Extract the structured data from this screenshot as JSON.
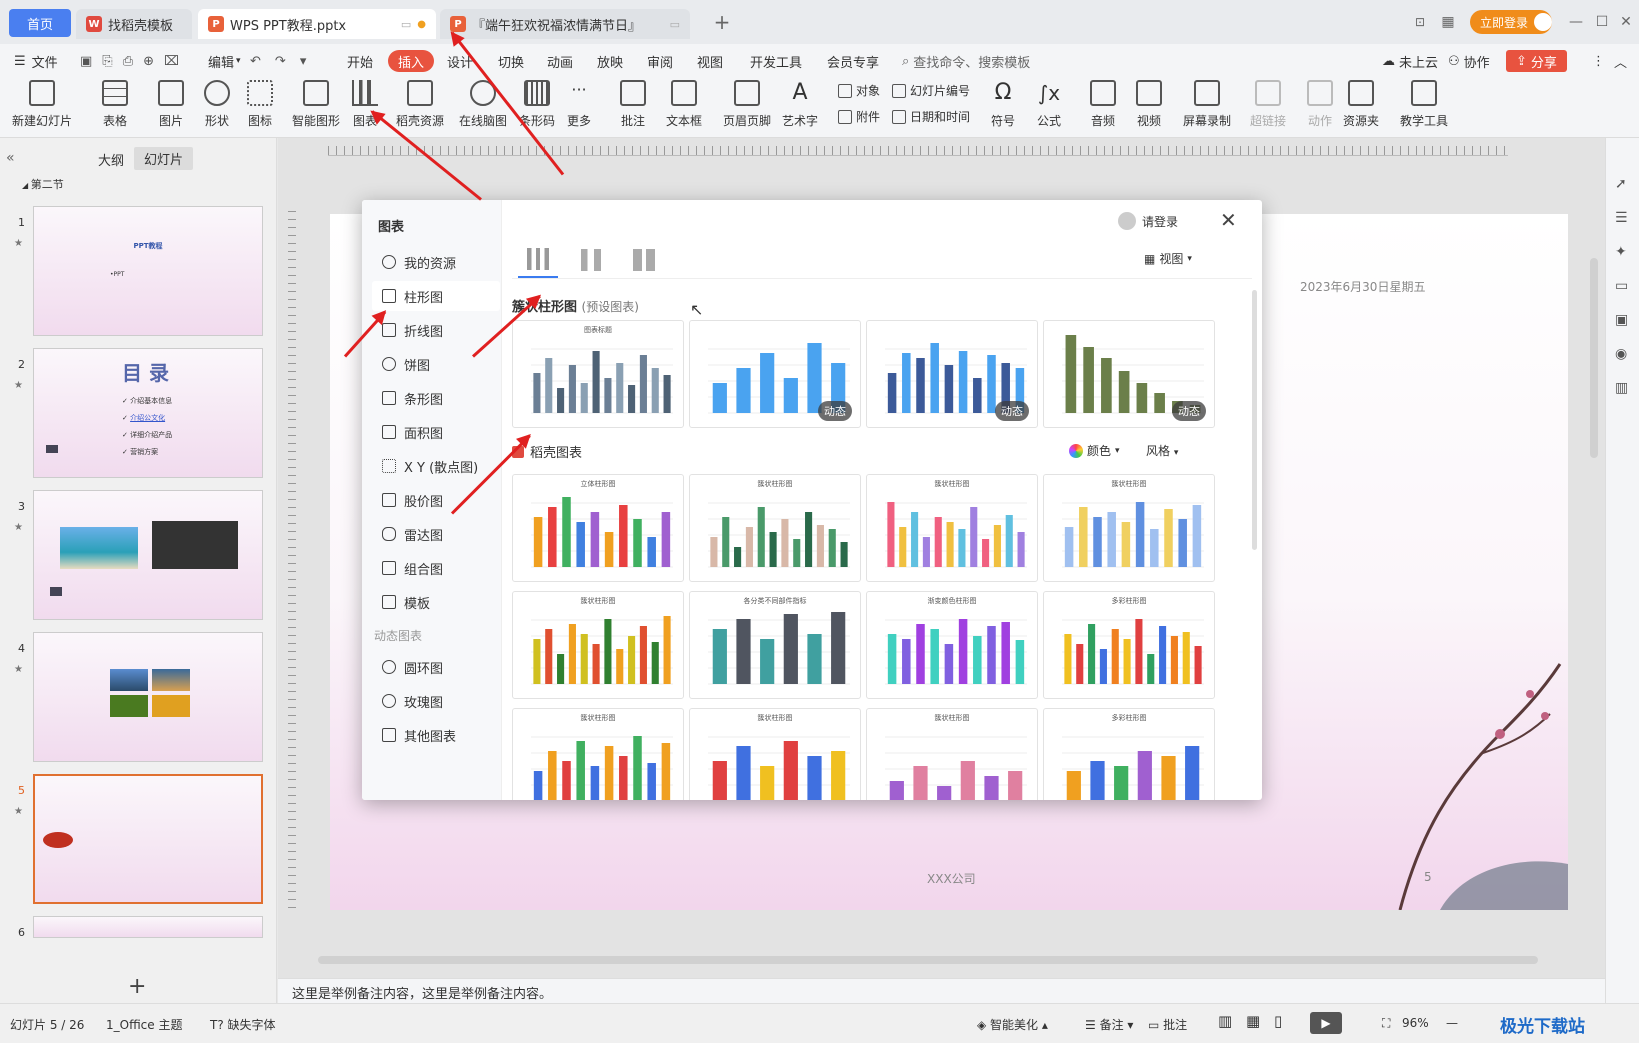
{
  "tabs": {
    "home": "首页",
    "tab1": "找稻壳模板",
    "tab2": "WPS PPT教程.pptx",
    "tab3": "『端午狂欢祝福浓情满节日』",
    "add": "+",
    "login": "立即登录"
  },
  "menu": {
    "file": "文件",
    "edit": "编辑",
    "items": [
      "开始",
      "插入",
      "设计",
      "切换",
      "动画",
      "放映",
      "审阅",
      "视图",
      "开发工具",
      "会员专享"
    ],
    "search": "查找命令、搜索模板",
    "cloud": "未上云",
    "collab": "协作",
    "share": "分享"
  },
  "ribbon": {
    "new_slide": "新建幻灯片",
    "table": "表格",
    "picture": "图片",
    "shape": "形状",
    "icon": "图标",
    "smart": "智能图形",
    "chart": "图表",
    "docer": "稻壳资源",
    "mindmap": "在线脑图",
    "barcode": "条形码",
    "more": "更多",
    "comment": "批注",
    "textbox": "文本框",
    "headerfooter": "页眉页脚",
    "wordart": "艺术字",
    "object": "对象",
    "attach": "附件",
    "slide_num": "幻灯片编号",
    "datetime": "日期和时间",
    "symbol": "符号",
    "formula": "公式",
    "audio": "音频",
    "video": "视频",
    "screenrec": "屏幕录制",
    "hyperlink": "超链接",
    "action": "动作",
    "resource": "资源夹",
    "teach": "教学工具"
  },
  "left_panel": {
    "outline": "大纲",
    "slides": "幻灯片",
    "section": "第二节",
    "numbers": [
      "1",
      "2",
      "3",
      "4",
      "5",
      "6"
    ],
    "s1_title": "PPT教程",
    "s1_sub": "•PPT",
    "s2_title": "目 录",
    "s2_items": [
      "介绍基本信息",
      "介绍公文化",
      "详细介绍产品",
      "营销方案"
    ]
  },
  "slide": {
    "date": "2023年6月30日星期五",
    "company": "XXX公司",
    "page": "5"
  },
  "dialog": {
    "title": "图表",
    "login": "请登录",
    "view": "视图",
    "categories": [
      "我的资源",
      "柱形图",
      "折线图",
      "饼图",
      "条形图",
      "面积图",
      "X Y (散点图)",
      "股价图",
      "雷达图",
      "组合图",
      "模板"
    ],
    "dynamic_header": "动态图表",
    "dynamic": [
      "圆环图",
      "玫瑰图",
      "其他图表"
    ],
    "section1": "簇状柱形图",
    "section1_sub": "(预设图表)",
    "section2": "稻壳图表",
    "color": "颜色",
    "style": "风格",
    "dyn_badge": "动态",
    "card_title_preset": "图表标题",
    "card_titles": [
      "立体柱形图",
      "簇状柱形图",
      "簇状柱形图",
      "簇状柱形图",
      "簇状柱形图",
      "各分类不同部件指标",
      "渐变颜色柱形图",
      "多彩柱形图",
      "簇状柱形图",
      "簇状柱形图",
      "簇状柱形图",
      "多彩柱形图"
    ]
  },
  "notes": "这里是举例备注内容，这里是举例备注内容。",
  "status": {
    "slide": "幻灯片 5 / 26",
    "theme": "1_Office 主题",
    "font": "缺失字体",
    "beautify": "智能美化",
    "notes": "备注",
    "comment": "批注",
    "zoom": "96%"
  },
  "watermark": "极光下载站",
  "colors": {
    "accent": "#e8533f",
    "blue": "#4a7ff0",
    "bar_blue": "#4aa3f0"
  }
}
